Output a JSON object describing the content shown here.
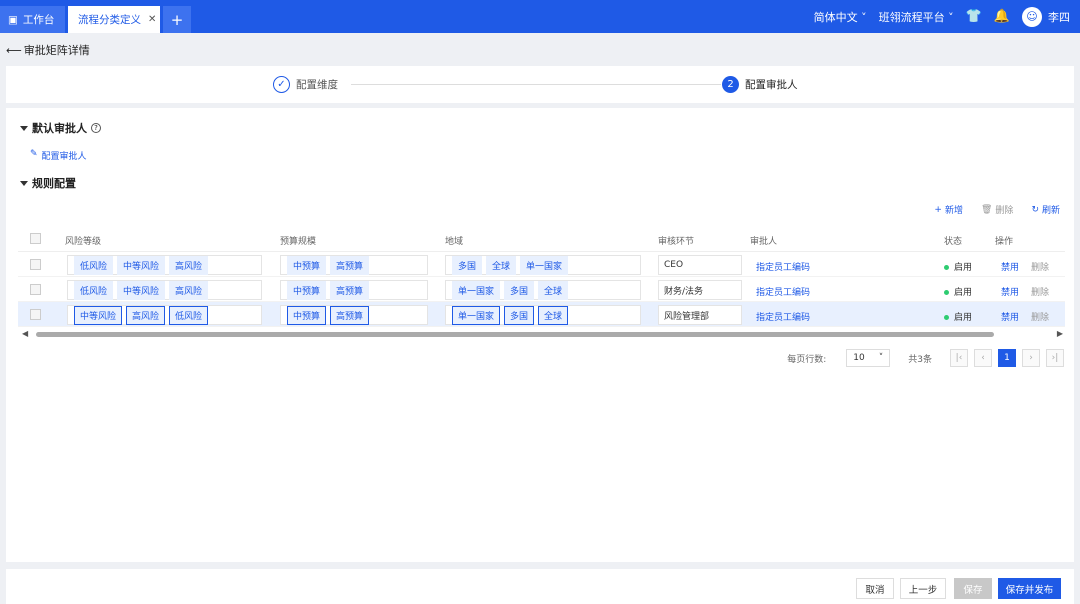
{
  "tabs": [
    {
      "label": "工作台"
    },
    {
      "label": "流程分类定义"
    },
    {
      "label": "+"
    }
  ],
  "header": {
    "language": "简体中文",
    "platform": "班翎流程平台",
    "user": "李四"
  },
  "page": {
    "title": "审批矩阵详情"
  },
  "steps": [
    {
      "label": "配置维度",
      "state": "done"
    },
    {
      "number": "2",
      "label": "配置审批人",
      "state": "active"
    }
  ],
  "sections": {
    "default_approver": "默认审批人",
    "config_approver_link": "配置审批人",
    "rule_config": "规则配置"
  },
  "toolbar": {
    "add": "新增",
    "delete": "删除",
    "refresh": "刷新"
  },
  "table": {
    "columns": [
      "风险等级",
      "预算规模",
      "地域",
      "审核环节",
      "审批人",
      "状态",
      "操作"
    ],
    "rows": [
      {
        "risk": [
          "低风险",
          "中等风险",
          "高风险"
        ],
        "budget": [
          "中预算",
          "高预算"
        ],
        "region": [
          "多国",
          "全球",
          "单一国家"
        ],
        "stage": "CEO",
        "approver": "指定员工编码",
        "status": "启用",
        "op1": "禁用",
        "op2": "删除"
      },
      {
        "risk": [
          "低风险",
          "中等风险",
          "高风险"
        ],
        "budget": [
          "中预算",
          "高预算"
        ],
        "region": [
          "单一国家",
          "多国",
          "全球"
        ],
        "stage": "财务/法务",
        "approver": "指定员工编码",
        "status": "启用",
        "op1": "禁用",
        "op2": "删除"
      },
      {
        "risk": [
          "中等风险",
          "高风险",
          "低风险"
        ],
        "budget": [
          "中预算",
          "高预算"
        ],
        "region": [
          "单一国家",
          "多国",
          "全球"
        ],
        "stage": "风险管理部",
        "approver": "指定员工编码",
        "status": "启用",
        "op1": "禁用",
        "op2": "删除"
      }
    ]
  },
  "pagination": {
    "rows_per_page_label": "每页行数:",
    "rows_per_page": "10",
    "total": "共3条",
    "current_page": "1"
  },
  "footer": {
    "cancel": "取消",
    "prev": "上一步",
    "save": "保存",
    "save_publish": "保存并发布"
  },
  "colors": {
    "brand": "#1f5ae6",
    "status_on": "#2ecc71"
  }
}
